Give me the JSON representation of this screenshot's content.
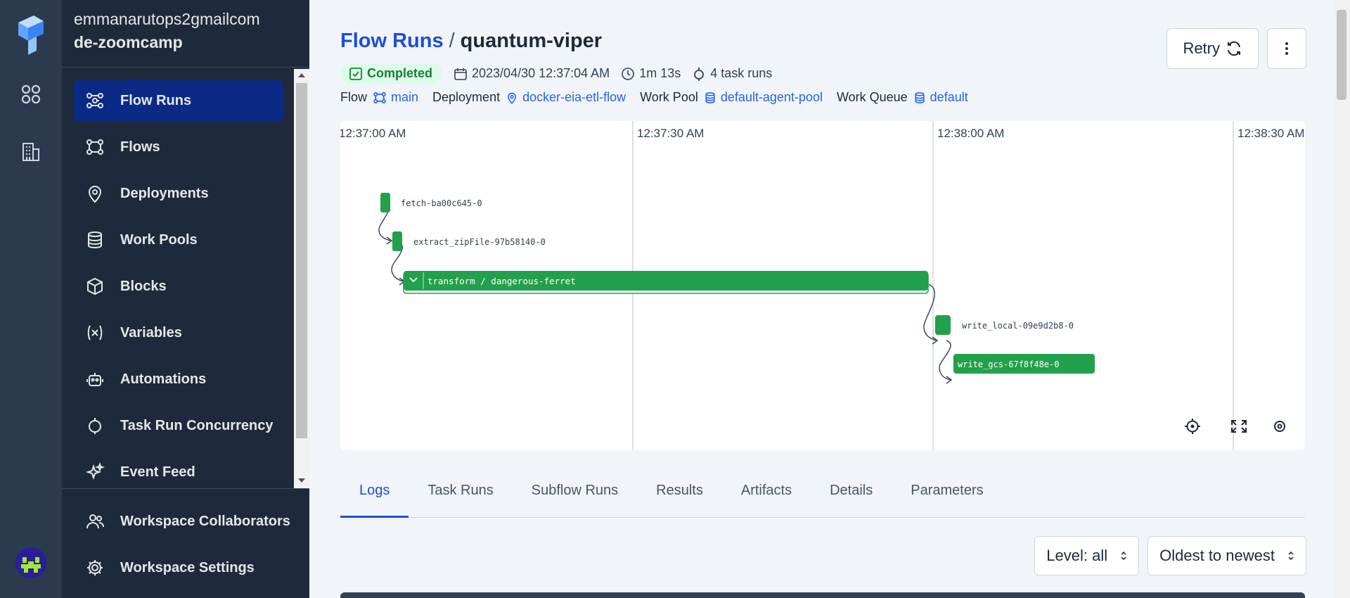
{
  "workspace": {
    "account": "emmanarutops2gmailcom",
    "name": "de-zoomcamp"
  },
  "nav": [
    {
      "label": "Flow Runs",
      "icon": "flow-runs-icon",
      "active": true
    },
    {
      "label": "Flows",
      "icon": "flows-icon"
    },
    {
      "label": "Deployments",
      "icon": "map-pin-icon"
    },
    {
      "label": "Work Pools",
      "icon": "database-icon"
    },
    {
      "label": "Blocks",
      "icon": "cube-icon"
    },
    {
      "label": "Variables",
      "icon": "variable-icon"
    },
    {
      "label": "Automations",
      "icon": "robot-icon"
    },
    {
      "label": "Task Run Concurrency",
      "icon": "concurrency-icon"
    },
    {
      "label": "Event Feed",
      "icon": "sparkles-icon"
    }
  ],
  "bottom_nav": [
    {
      "label": "Workspace Collaborators",
      "icon": "users-icon"
    },
    {
      "label": "Workspace Settings",
      "icon": "gear-icon"
    }
  ],
  "breadcrumb": {
    "parent": "Flow Runs",
    "separator": "/",
    "current": "quantum-viper"
  },
  "actions": {
    "retry": "Retry"
  },
  "meta": {
    "status": "Completed",
    "start_time": "2023/04/30 12:37:04 AM",
    "duration": "1m 13s",
    "task_runs": "4 task runs"
  },
  "details": {
    "flow_label": "Flow",
    "flow": "main",
    "deployment_label": "Deployment",
    "deployment": "docker-eia-etl-flow",
    "work_pool_label": "Work Pool",
    "work_pool": "default-agent-pool",
    "work_queue_label": "Work Queue",
    "work_queue": "default"
  },
  "timeline": {
    "ticks": [
      "12:37:00 AM",
      "12:37:30 AM",
      "12:38:00 AM",
      "12:38:30 AM"
    ],
    "nodes": [
      {
        "label": "fetch-ba00c645-0"
      },
      {
        "label": "extract_zipFile-97b58140-0"
      },
      {
        "label": "transform / dangerous-ferret"
      },
      {
        "label": "write_local-09e9d2b8-0"
      },
      {
        "label": "write_gcs-67f8f48e-0"
      }
    ],
    "node_color": "#22a04b"
  },
  "tabs": [
    "Logs",
    "Task Runs",
    "Subflow Runs",
    "Results",
    "Artifacts",
    "Details",
    "Parameters"
  ],
  "active_tab": "Logs",
  "filters": {
    "level": "Level: all",
    "order": "Oldest to newest"
  }
}
